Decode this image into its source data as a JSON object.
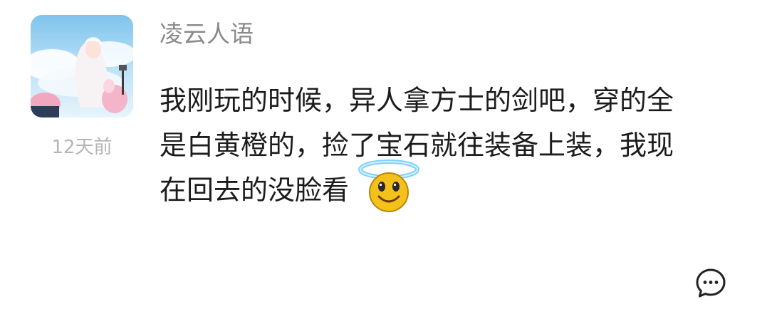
{
  "comment": {
    "username": "凌云人语",
    "time": "12天前",
    "text_lines": [
      "我刚玩的时候，异人拿方士的剑吧，穿的全",
      "是白黄橙的，捡了宝石就往装备上装，我现",
      "在回去的没脸看"
    ],
    "emoji": "halo-smiley-emoji",
    "avatar": "anime-girl-avatar"
  },
  "actions": {
    "reply_icon": "comment-bubble-icon"
  },
  "colors": {
    "username": "#8a8a8a",
    "time": "#b5b5b5",
    "text": "#1c1c1c",
    "icon": "#222222"
  }
}
